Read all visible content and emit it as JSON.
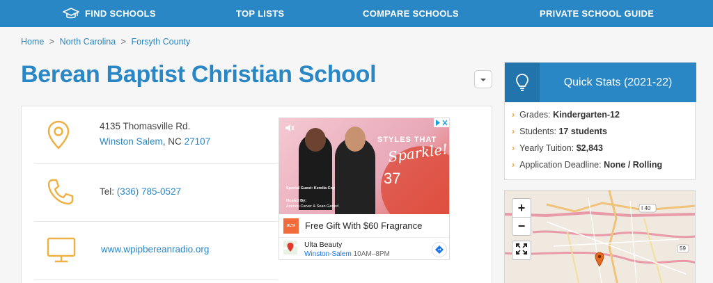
{
  "nav": {
    "items": [
      {
        "label": "FIND SCHOOLS",
        "icon": "graduation-cap-icon"
      },
      {
        "label": "TOP LISTS"
      },
      {
        "label": "COMPARE SCHOOLS"
      },
      {
        "label": "PRIVATE SCHOOL GUIDE"
      }
    ]
  },
  "breadcrumb": {
    "home": "Home",
    "state": "North Carolina",
    "county": "Forsyth County",
    "separator": ">"
  },
  "school": {
    "name": "Berean Baptist Christian School",
    "street": "4135 Thomasville Rd.",
    "city": "Winston Salem",
    "state_sep": ", NC ",
    "zip": "27107",
    "phone_label": "Tel: ",
    "phone": "(336) 785-0527",
    "website": "www.wpipbereanradio.org"
  },
  "ad": {
    "headline": "STYLES THAT",
    "headline_script": "Sparkle!",
    "episode": "37",
    "guest_label": "Special Guest: Kerelia Coy",
    "hosted_label": "Hosted By:",
    "hosts": "Ammon Carver & Sean Gerard",
    "copy": "Free Gift With $60 Fragrance",
    "brand": "Ulta Beauty",
    "city": "Winston-Salem",
    "hours": "10AM–8PM",
    "ulta_logo": "ULTA"
  },
  "quick_stats": {
    "title": "Quick Stats (2021-22)",
    "items": [
      {
        "label": "Grades: ",
        "value": "Kindergarten-12"
      },
      {
        "label": "Students: ",
        "value": "17 students"
      },
      {
        "label": "Yearly Tuition: ",
        "value": "$2,843"
      },
      {
        "label": "Application Deadline: ",
        "value": "None / Rolling"
      }
    ]
  },
  "map": {
    "zoom_in": "+",
    "zoom_out": "−",
    "road_label_1": "I 40",
    "road_label_2": "59"
  },
  "colors": {
    "brand_blue": "#2a87c5",
    "accent_orange": "#e8a83b",
    "marker": "#e3681e"
  }
}
